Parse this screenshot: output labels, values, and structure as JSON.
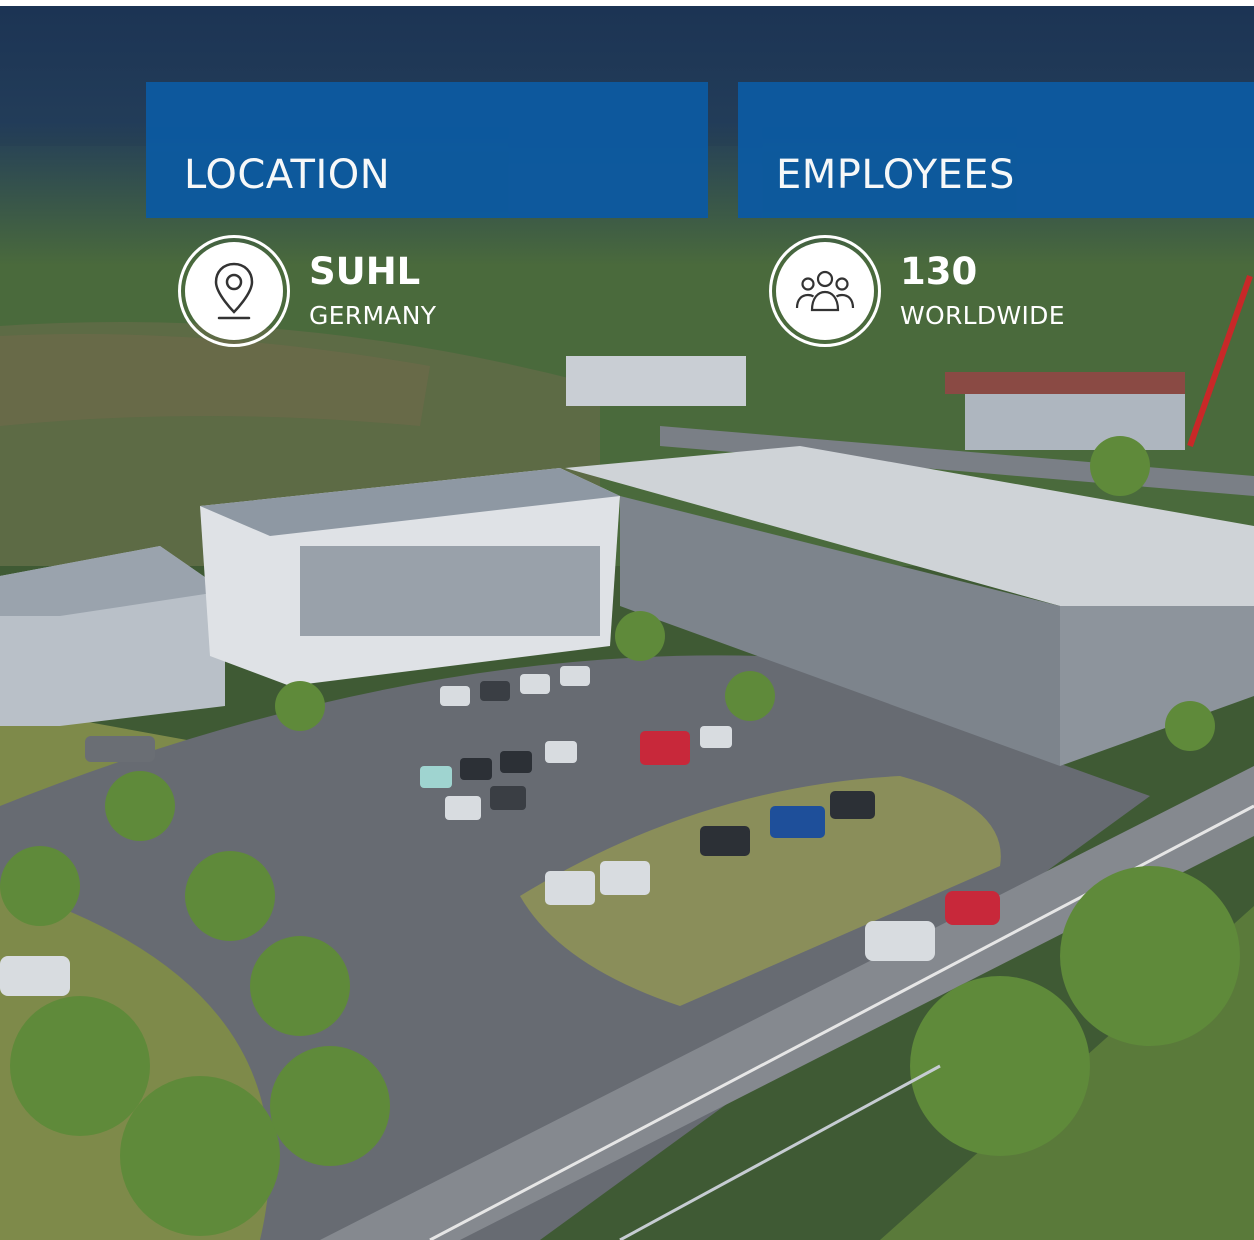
{
  "colors": {
    "banner": "#0c5aa0",
    "text": "#ffffff",
    "sky": "#1c3454"
  },
  "location": {
    "label": "LOCATION",
    "icon": "map-pin-icon",
    "value": "SUHL",
    "sub": "GERMANY"
  },
  "employees": {
    "label": "EMPLOYEES",
    "icon": "people-group-icon",
    "value": "130",
    "sub": "WORLDWIDE"
  }
}
